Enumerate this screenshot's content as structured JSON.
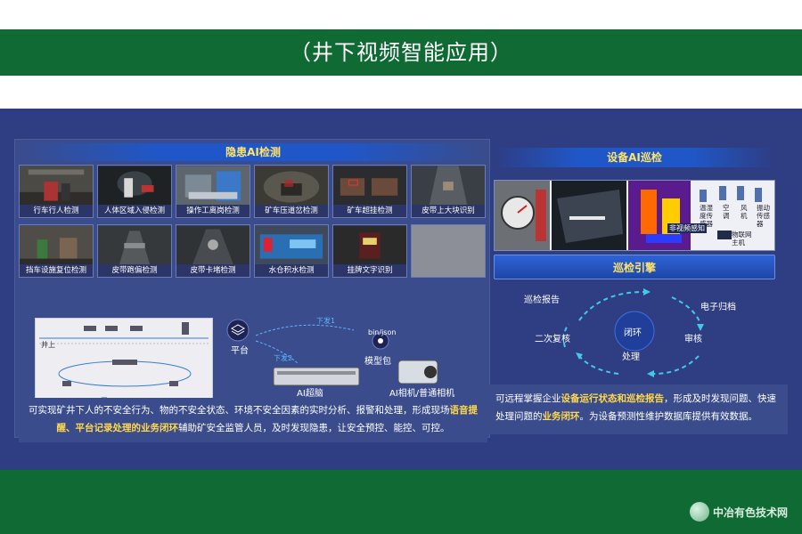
{
  "header": {
    "title": "（井下视频智能应用）"
  },
  "left": {
    "title": "隐患AI检测",
    "thumbs_row1": [
      "行车行人检测",
      "人体区域入侵检测",
      "操作工离岗检测",
      "矿车压道岔检测",
      "矿车超挂检测",
      "皮带上大块识别"
    ],
    "thumbs_row2": [
      "挡车设施复位检测",
      "皮带跑偏检测",
      "皮带卡堵检测",
      "水仓积水检测",
      "挂牌文字识别"
    ],
    "diagram": {
      "well_label": "井上"
    },
    "arch": {
      "platform": "平台",
      "model_pkg": "模型包",
      "bin_json": "bin/json",
      "step1": "下发1",
      "step2": "下发2",
      "ai_brain": "AI超脑",
      "ai_camera": "AI相机/普通相机"
    },
    "desc": {
      "part1": "可实现矿井下人的不安全行为、物的不安全状态、环境不安全因素的实时分析、报警和处理，形成现场",
      "hl1": "语音提醒、平台记录处理的业务闭环",
      "part2": "辅助矿安全监管人员，及时发现隐患，让安全预控、能控、可控。"
    }
  },
  "right": {
    "title": "设备AI巡检",
    "sensors": [
      "温湿度传感器",
      "空调",
      "风机",
      "振动传感器"
    ],
    "gateway": "物联网主机",
    "nonvideo": "非视频感知",
    "engine": "巡检引擎",
    "cycle": {
      "center": "闭环",
      "report": "巡检报告",
      "archive": "电子归档",
      "review2": "二次复核",
      "audit": "审核",
      "process": "处理"
    },
    "desc": {
      "part1": "可远程掌握企业",
      "hl1": "设备运行状态和巡检报告",
      "part2": "，形成及时发现问题、快速处理问题的",
      "hl2": "业务闭环",
      "part3": "。为设备预测性维护数据库提供有效数据。"
    }
  },
  "footer": {
    "logo_text": "中冶有色技术网"
  },
  "colors": {
    "green": "#0f6b33",
    "navy": "#2f3d83",
    "accent": "#ffd84a"
  }
}
